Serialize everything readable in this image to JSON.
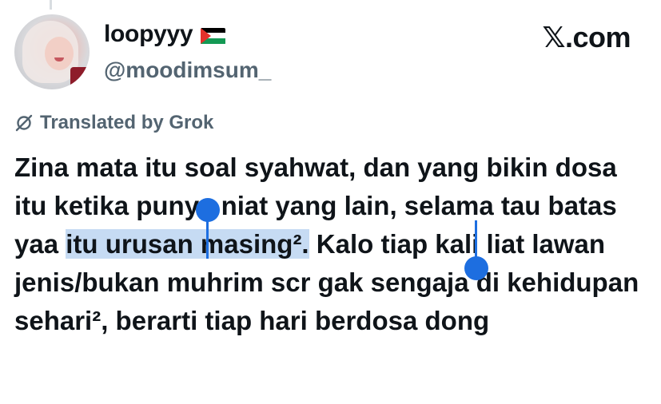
{
  "header": {
    "display_name": "loopyyy",
    "flag_icon": "palestine-flag-icon",
    "handle": "@moodimsum_",
    "brand": "𝕏.com"
  },
  "translation": {
    "icon": "grok-icon",
    "label": "Translated by Grok"
  },
  "tweet": {
    "before": "Zina mata itu soal syahwat, dan yang bikin dosa itu ketika punya niat yang lain, selama tau batas yaa ",
    "selected": "itu urusan masing².",
    "after": " Kalo tiap kali liat lawan jenis/bukan muhrim scr gak sengaja di kehidupan sehari², berarti tiap hari berdosa dong"
  },
  "colors": {
    "selection": "#c6dbf3",
    "handles": "#1d6ee0",
    "secondary_text": "#536471"
  }
}
